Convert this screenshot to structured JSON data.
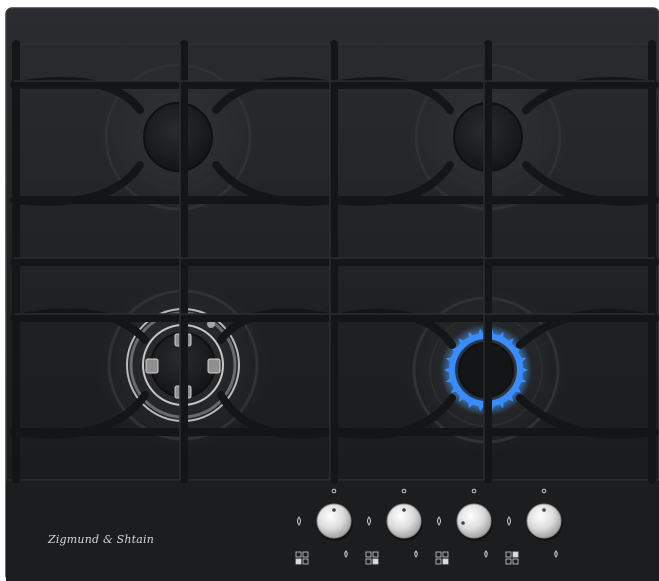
{
  "product": {
    "brand_logo_text": "Zigmund & Shtain",
    "type": "gas-hob",
    "glass_color": "#202224",
    "grate_color": "#1a1b1d"
  },
  "burners": [
    {
      "position": "top-left",
      "state": "off"
    },
    {
      "position": "top-right",
      "state": "off"
    },
    {
      "position": "bottom-left",
      "state": "off",
      "style": "triple-crown-wok"
    },
    {
      "position": "bottom-right",
      "state": "lit",
      "flame_color": "#3b8cff"
    }
  ],
  "controls": [
    {
      "knob": 1,
      "position_indicator": "top"
    },
    {
      "knob": 2,
      "position_indicator": "top"
    },
    {
      "knob": 3,
      "position_indicator": "left"
    },
    {
      "knob": 4,
      "position_indicator": "top"
    }
  ]
}
